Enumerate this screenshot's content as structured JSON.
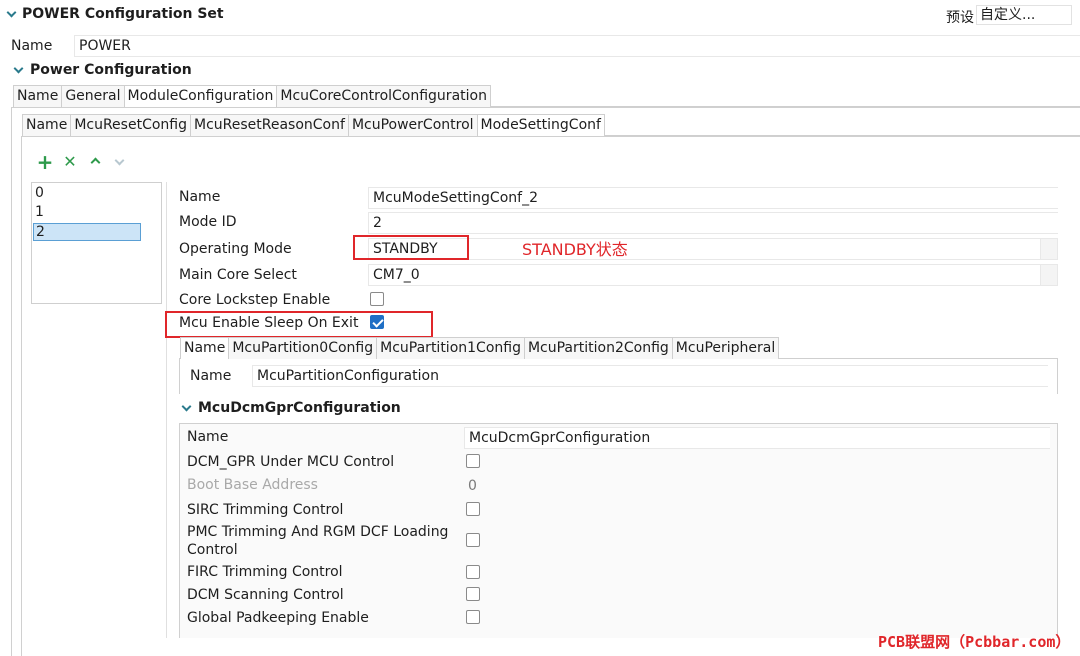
{
  "header": {
    "title": "POWER Configuration Set",
    "preset_label": "预设",
    "preset_value": "自定义..."
  },
  "top_name": {
    "label": "Name",
    "value": "POWER"
  },
  "power_section": {
    "title": "Power Configuration"
  },
  "tabs_level1": [
    "Name",
    "General",
    "ModuleConfiguration",
    "McuCoreControlConfiguration"
  ],
  "tabs_level2": [
    "Name",
    "McuResetConfig",
    "McuResetReasonConf",
    "McuPowerControl",
    "ModeSettingConf"
  ],
  "list_items": [
    "0",
    "1",
    "2"
  ],
  "mode_form": {
    "name_label": "Name",
    "name_value": "McuModeSettingConf_2",
    "mode_id_label": "Mode ID",
    "mode_id_value": "2",
    "operating_mode_label": "Operating Mode",
    "operating_mode_value": "STANDBY",
    "main_core_label": "Main Core Select",
    "main_core_value": "CM7_0",
    "lockstep_label": "Core Lockstep Enable",
    "sleep_on_exit_label": "Mcu Enable Sleep On Exit"
  },
  "annotation": "STANDBY状态",
  "tabs_level3": [
    "Name",
    "McuPartition0Config",
    "McuPartition1Config",
    "McuPartition2Config",
    "McuPeripheral"
  ],
  "partition": {
    "name_label": "Name",
    "name_value": "McuPartitionConfiguration"
  },
  "dcm": {
    "title": "McuDcmGprConfiguration",
    "name_label": "Name",
    "name_value": "McuDcmGprConfiguration",
    "rows": [
      "DCM_GPR Under MCU Control",
      "Boot Base Address",
      "SIRC Trimming Control",
      "PMC Trimming And RGM DCF Loading",
      "Control",
      "FIRC Trimming Control",
      "DCM Scanning Control",
      "Global Padkeeping Enable"
    ],
    "boot_base_value": "0"
  },
  "watermark": "PCB联盟网（Pcbbar.com）",
  "colors": {
    "accent": "#1f6fc5",
    "highlight": "#e0262a",
    "teal": "#2a7a8c"
  }
}
